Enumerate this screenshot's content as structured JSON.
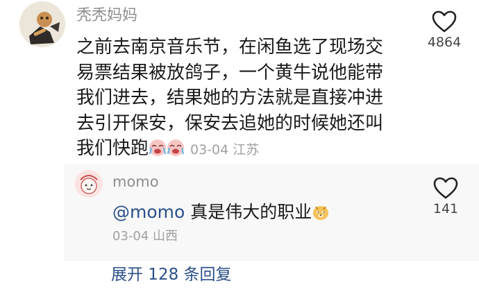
{
  "comment": {
    "username": "秃秃妈妈",
    "lines": [
      "之前去南京音乐节，在闲鱼选了现场交",
      "易票结果被放鸽子，一个黄牛说他能带",
      "我们进去，结果她的方法就是直接冲进",
      "去引开保安，保安去追她的时候她还叫",
      "我们快跑"
    ],
    "date": "03-04",
    "location": "江苏",
    "like_count": "4864",
    "emoji_names": [
      "crying-laughing-emoji",
      "crying-laughing-emoji"
    ]
  },
  "reply": {
    "username": "momo",
    "mention": "@momo",
    "text": "真是伟大的职业",
    "date": "03-04",
    "location": "山西",
    "like_count": "141",
    "emoji_name": "doge-emoji"
  },
  "expand": {
    "label": "展开 128 条回复"
  },
  "colors": {
    "username": "#8d8d8d",
    "text": "#1a1a1a",
    "meta": "#a0a0a0",
    "link": "#2a4f8a",
    "reply_bg": "#f8f8f8"
  }
}
